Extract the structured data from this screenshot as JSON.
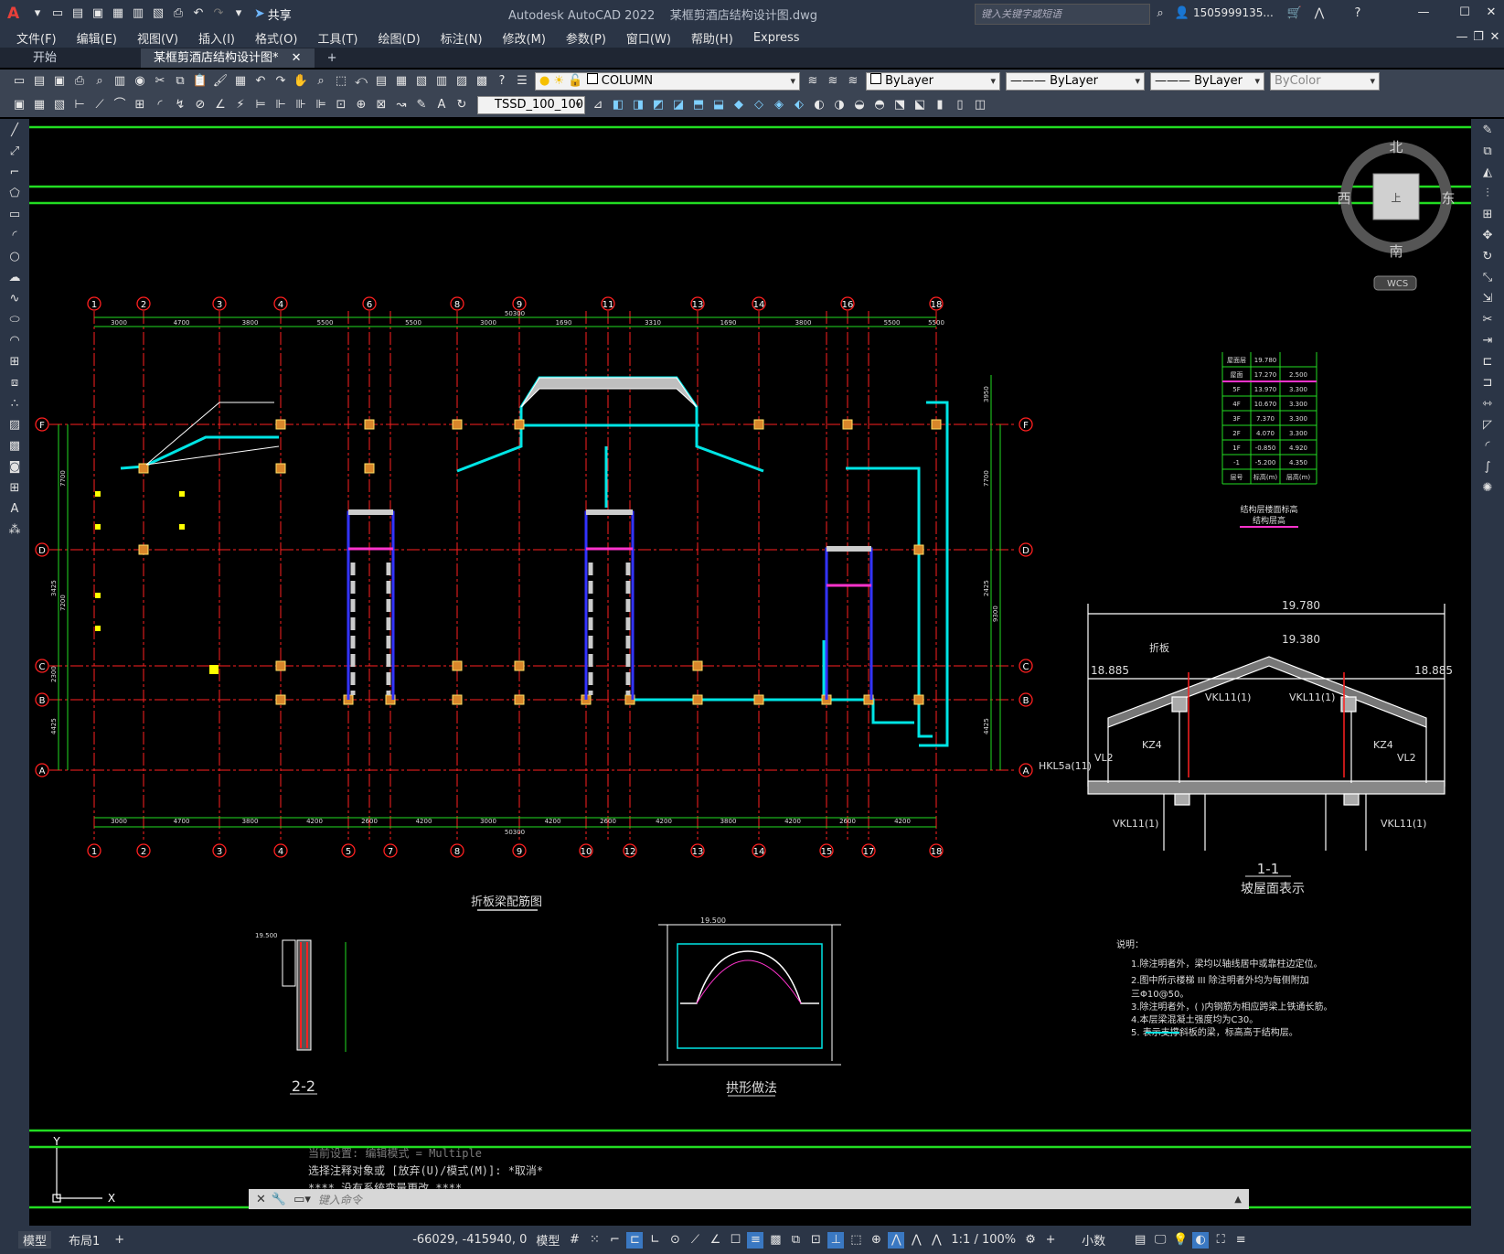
{
  "titlebar": {
    "app_title": "Autodesk AutoCAD 2022",
    "file_name": "某框剪酒店结构设计图.dwg",
    "share_label": "共享",
    "search_placeholder": "键入关键字或短语",
    "user": "1505999135...",
    "menu_letter": "A"
  },
  "menu": [
    "文件(F)",
    "编辑(E)",
    "视图(V)",
    "插入(I)",
    "格式(O)",
    "工具(T)",
    "绘图(D)",
    "标注(N)",
    "修改(M)",
    "参数(P)",
    "窗口(W)",
    "帮助(H)",
    "Express"
  ],
  "tabs": [
    {
      "label": "开始"
    },
    {
      "label": "某框剪酒店结构设计图*"
    }
  ],
  "toolbar": {
    "layer": "COLUMN",
    "color": "ByLayer",
    "linetype": "ByLayer",
    "lineweight": "ByLayer",
    "plotstyle": "ByColor",
    "dimstyle": "TSSD_100_100"
  },
  "viewcube": {
    "north": "北",
    "south": "南",
    "east": "东",
    "west": "西",
    "top": "上",
    "wcs": "WCS"
  },
  "drawing": {
    "axes_top": [
      "1",
      "2",
      "3",
      "4",
      "6",
      "8",
      "9",
      "11",
      "13",
      "14",
      "16",
      "18"
    ],
    "axes_bottom": [
      "1",
      "2",
      "3",
      "4",
      "5",
      "7",
      "8",
      "9",
      "10",
      "12",
      "13",
      "14",
      "15",
      "17",
      "18"
    ],
    "axes_rows": [
      "F",
      "D",
      "C",
      "B",
      "A"
    ],
    "top_dims": [
      "3000",
      "4700",
      "3800",
      "5500",
      "5500",
      "3000",
      "1690",
      "3310",
      "1690",
      "3800",
      "5500",
      "5500"
    ],
    "top_total": "50300",
    "bottom_dims": [
      "3000",
      "4700",
      "3800",
      "4200",
      "2600",
      "4200",
      "3000",
      "4200",
      "2600",
      "4200",
      "3800",
      "4200",
      "2600",
      "4200"
    ],
    "bottom_total": "50300",
    "left_dims": [
      "7700",
      "7200",
      "3425",
      "2300",
      "4425"
    ],
    "right_dims": [
      "3950",
      "7700",
      "9300",
      "2425",
      "4425"
    ],
    "title_main": "折板梁配筋图",
    "title_section": "1-1",
    "title_section_sub": "坡屋面表示",
    "title_22": "2-2",
    "title_arch": "拱形做法",
    "elev_19780": "19.780",
    "elev_19380": "19.380",
    "elev_18885": "18.885",
    "elev_19500": "19.500",
    "sec_labels": {
      "zheban": "折板",
      "vkl1": "VKL11(1)",
      "kz4": "KZ4",
      "vl2": "VL2",
      "hkl": "HKL5a(11)"
    },
    "table": {
      "rows": [
        [
          "屋面层",
          "19.780",
          ""
        ],
        [
          "屋面",
          "17.270",
          "2.500"
        ],
        [
          "5F",
          "13.970",
          "3.300"
        ],
        [
          "4F",
          "10.670",
          "3.300"
        ],
        [
          "3F",
          "7.370",
          "3.300"
        ],
        [
          "2F",
          "4.070",
          "3.300"
        ],
        [
          "1F",
          "-0.850",
          "4.920"
        ],
        [
          "-1",
          "-5.200",
          "4.350"
        ],
        [
          "层号",
          "标高(m)",
          "层高(m)"
        ]
      ],
      "caption1": "结构层楼面标高",
      "caption2": "结构层高"
    },
    "notes": {
      "title": "说明：",
      "items": [
        "1.除注明者外，梁均以轴线居中或靠柱边定位。",
        "2.图中所示楼梯 III  除注明者外均为每侧附加",
        "   三Φ10@50。",
        "3.除注明者外，( )内钢筋为相应跨梁上铁通长筋。",
        "4.本层梁混凝土强度均为C30。",
        "5.            表示支撑斜板的梁，标高高于结构层。"
      ]
    }
  },
  "command": {
    "history": [
      "当前设置: 编辑模式 = Multiple",
      "选择注释对象或 [放弃(U)/模式(M)]: *取消*",
      "**** 没有系统变量更改 ****"
    ],
    "placeholder": "键入命令"
  },
  "status": {
    "model_tab": "模型",
    "layout_tab": "布局1",
    "coords": "-66029, -415940, 0",
    "space": "模型",
    "scale": "1:1 / 100%",
    "units": "小数"
  },
  "colors": {
    "axis": "#ff2020",
    "green": "#22dd22",
    "cyan": "#00e5e5",
    "yellow": "#ffff00",
    "magenta": "#ff33cc",
    "purple": "#3333ff"
  }
}
